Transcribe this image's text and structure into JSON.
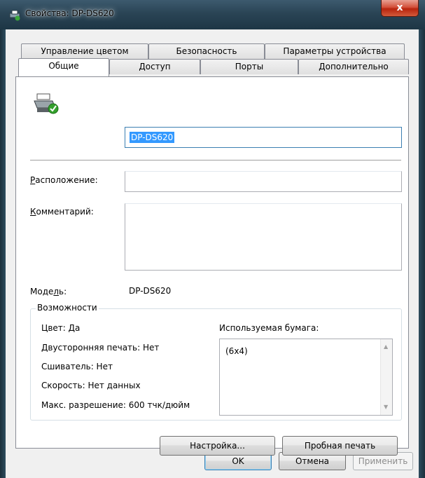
{
  "window": {
    "title_prefix": "Свойства: ",
    "title_name": "DP-DS620",
    "close_label": "x"
  },
  "tabs_row1": [
    "Управление цветом",
    "Безопасность",
    "Параметры устройства"
  ],
  "tabs_row2": [
    "Общие",
    "Доступ",
    "Порты",
    "Дополнительно"
  ],
  "general": {
    "printer_name": "DP-DS620",
    "location_label": "Расположение:",
    "location_value": "",
    "comment_label": "Комментарий:",
    "comment_value": "",
    "model_label": "Модель:",
    "model_value": "DP-DS620"
  },
  "features": {
    "title": "Возможности",
    "color": "Цвет: Да",
    "duplex": "Двусторонняя печать: Нет",
    "staple": "Сшиватель: Нет",
    "speed": "Скорость: Нет данных",
    "resolution": "Макс. разрешение: 600 тчк/дюйм",
    "paper_label": "Используемая бумага:",
    "paper_items": [
      "(6x4)"
    ]
  },
  "buttons": {
    "settings": "Настройка...",
    "test_print": "Пробная печать",
    "ok": "OK",
    "cancel": "Отмена",
    "apply": "Применить"
  },
  "colors": {
    "selection": "#3399ff",
    "title_bar": "#2a4455",
    "close_button": "#c63b22"
  }
}
